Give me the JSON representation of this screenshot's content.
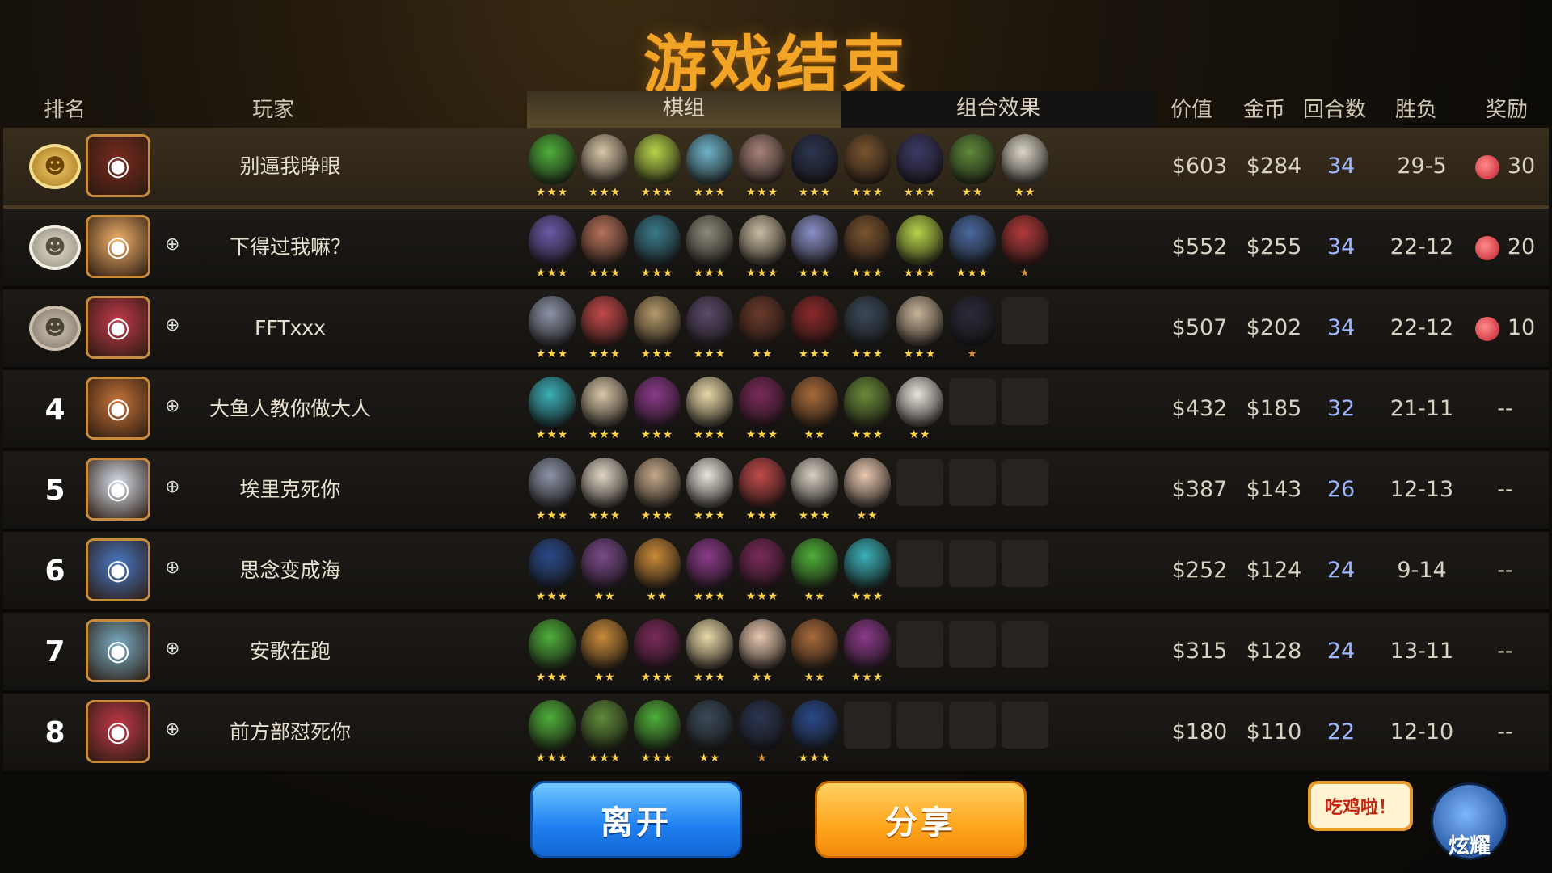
{
  "title": "游戏结束",
  "headers": {
    "rank": "排名",
    "player": "玩家",
    "value": "价值",
    "gold": "金币",
    "rounds": "回合数",
    "record": "胜负",
    "reward": "奖励"
  },
  "tabs": [
    {
      "label": "棋组",
      "active": true
    },
    {
      "label": "组合效果",
      "active": false
    }
  ],
  "rows": [
    {
      "rank": "1",
      "medal": "gold-laurel",
      "avatar_color": "#7a2a1e",
      "friend_icon": "",
      "name": "别逼我睁眼",
      "value": "$603",
      "gold": "$284",
      "rounds": "34",
      "record": "29-5",
      "reward": "30",
      "units": [
        {
          "color": "#4fae3a",
          "stars": 3
        },
        {
          "color": "#d8c6a8",
          "stars": 3
        },
        {
          "color": "#b7d44a",
          "stars": 3
        },
        {
          "color": "#6fb3c8",
          "stars": 3
        },
        {
          "color": "#a8837a",
          "stars": 3
        },
        {
          "color": "#2b3550",
          "stars": 3
        },
        {
          "color": "#7a5430",
          "stars": 3
        },
        {
          "color": "#3c3a66",
          "stars": 3
        },
        {
          "color": "#5f8a3a",
          "stars": 2
        },
        {
          "color": "#dcd6c8",
          "stars": 2
        }
      ],
      "empty": 0
    },
    {
      "rank": "2",
      "medal": "silver-laurel",
      "avatar_color": "#f3b26a",
      "friend_icon": "add-friend",
      "name": "下得过我嘛？",
      "value": "$552",
      "gold": "$255",
      "rounds": "34",
      "record": "22-12",
      "reward": "20",
      "units": [
        {
          "color": "#6a5aa8",
          "stars": 3
        },
        {
          "color": "#b5725a",
          "stars": 3
        },
        {
          "color": "#3a7a8a",
          "stars": 3
        },
        {
          "color": "#8c8a7a",
          "stars": 3
        },
        {
          "color": "#c9bca2",
          "stars": 3
        },
        {
          "color": "#8a90c8",
          "stars": 3
        },
        {
          "color": "#7a5430",
          "stars": 3
        },
        {
          "color": "#b7d44a",
          "stars": 3
        },
        {
          "color": "#4a6aa0",
          "stars": 3
        },
        {
          "color": "#b03a3a",
          "stars": 1
        }
      ],
      "empty": 0
    },
    {
      "rank": "3",
      "medal": "bronze-laurel",
      "avatar_color": "#c23a4a",
      "friend_icon": "add-friend",
      "name": "FFTxxx",
      "value": "$507",
      "gold": "$202",
      "rounds": "34",
      "record": "22-12",
      "reward": "10",
      "units": [
        {
          "color": "#8c94a8",
          "stars": 3
        },
        {
          "color": "#c24a4a",
          "stars": 3
        },
        {
          "color": "#b59a6a",
          "stars": 3
        },
        {
          "color": "#5a4a6a",
          "stars": 3
        },
        {
          "color": "#6a3a2a",
          "stars": 2
        },
        {
          "color": "#8a2a2a",
          "stars": 3
        },
        {
          "color": "#3a4a5a",
          "stars": 3
        },
        {
          "color": "#c8b49a",
          "stars": 3
        },
        {
          "color": "#2a2a3a",
          "stars": 1
        }
      ],
      "empty": 1
    },
    {
      "rank": "4",
      "medal": "",
      "avatar_color": "#c8743a",
      "friend_icon": "add-friend",
      "name": "大鱼人教你做大人",
      "value": "$432",
      "gold": "$185",
      "rounds": "32",
      "record": "21-11",
      "reward": "--",
      "units": [
        {
          "color": "#3ab0b8",
          "stars": 3
        },
        {
          "color": "#d8c6a8",
          "stars": 3
        },
        {
          "color": "#8a3a8a",
          "stars": 3
        },
        {
          "color": "#e8d8a8",
          "stars": 3
        },
        {
          "color": "#7a2a5a",
          "stars": 3
        },
        {
          "color": "#a86a3a",
          "stars": 2
        },
        {
          "color": "#6a8a3a",
          "stars": 3
        },
        {
          "color": "#e8e4dc",
          "stars": 2
        }
      ],
      "empty": 2
    },
    {
      "rank": "5",
      "medal": "",
      "avatar_color": "#d8e0ec",
      "friend_icon": "add-friend",
      "name": "埃里克死你",
      "value": "$387",
      "gold": "$143",
      "rounds": "26",
      "record": "12-13",
      "reward": "--",
      "units": [
        {
          "color": "#8c94a8",
          "stars": 3
        },
        {
          "color": "#e0d6c6",
          "stars": 3
        },
        {
          "color": "#c4a88a",
          "stars": 3
        },
        {
          "color": "#e8e4dc",
          "stars": 3
        },
        {
          "color": "#c24a4a",
          "stars": 3
        },
        {
          "color": "#d8d0c4",
          "stars": 3
        },
        {
          "color": "#e8c8b0",
          "stars": 2
        }
      ],
      "empty": 3
    },
    {
      "rank": "6",
      "medal": "",
      "avatar_color": "#4a7ac8",
      "friend_icon": "add-friend",
      "name": "思念变成海",
      "value": "$252",
      "gold": "$124",
      "rounds": "24",
      "record": "9-14",
      "reward": "--",
      "units": [
        {
          "color": "#2a4a8a",
          "stars": 3
        },
        {
          "color": "#7a4a8a",
          "stars": 2
        },
        {
          "color": "#c88a3a",
          "stars": 2
        },
        {
          "color": "#8a3a8a",
          "stars": 3
        },
        {
          "color": "#7a2a5a",
          "stars": 3
        },
        {
          "color": "#4fae3a",
          "stars": 2
        },
        {
          "color": "#3ab0b8",
          "stars": 3
        }
      ],
      "empty": 3
    },
    {
      "rank": "7",
      "medal": "",
      "avatar_color": "#7ab0c8",
      "friend_icon": "add-friend",
      "name": "安歌在跑",
      "value": "$315",
      "gold": "$128",
      "rounds": "24",
      "record": "13-11",
      "reward": "--",
      "units": [
        {
          "color": "#4fae3a",
          "stars": 3
        },
        {
          "color": "#c88a3a",
          "stars": 2
        },
        {
          "color": "#7a2a5a",
          "stars": 3
        },
        {
          "color": "#e8d8a8",
          "stars": 3
        },
        {
          "color": "#e8c8b0",
          "stars": 2
        },
        {
          "color": "#a86a3a",
          "stars": 2
        },
        {
          "color": "#8a3a8a",
          "stars": 3
        }
      ],
      "empty": 3
    },
    {
      "rank": "8",
      "medal": "",
      "avatar_color": "#c23a4a",
      "friend_icon": "add-friend",
      "name": "前方部怼死你",
      "value": "$180",
      "gold": "$110",
      "rounds": "22",
      "record": "12-10",
      "reward": "--",
      "units": [
        {
          "color": "#4fae3a",
          "stars": 3
        },
        {
          "color": "#5f8a3a",
          "stars": 3
        },
        {
          "color": "#4fae3a",
          "stars": 3
        },
        {
          "color": "#3a4a5a",
          "stars": 2
        },
        {
          "color": "#2b3550",
          "stars": 1
        },
        {
          "color": "#2a4a8a",
          "stars": 3
        }
      ],
      "empty": 4
    }
  ],
  "buttons": {
    "leave": "离开",
    "share": "分享"
  },
  "bubble": "吃鸡啦！",
  "mascot_label": "炫耀"
}
